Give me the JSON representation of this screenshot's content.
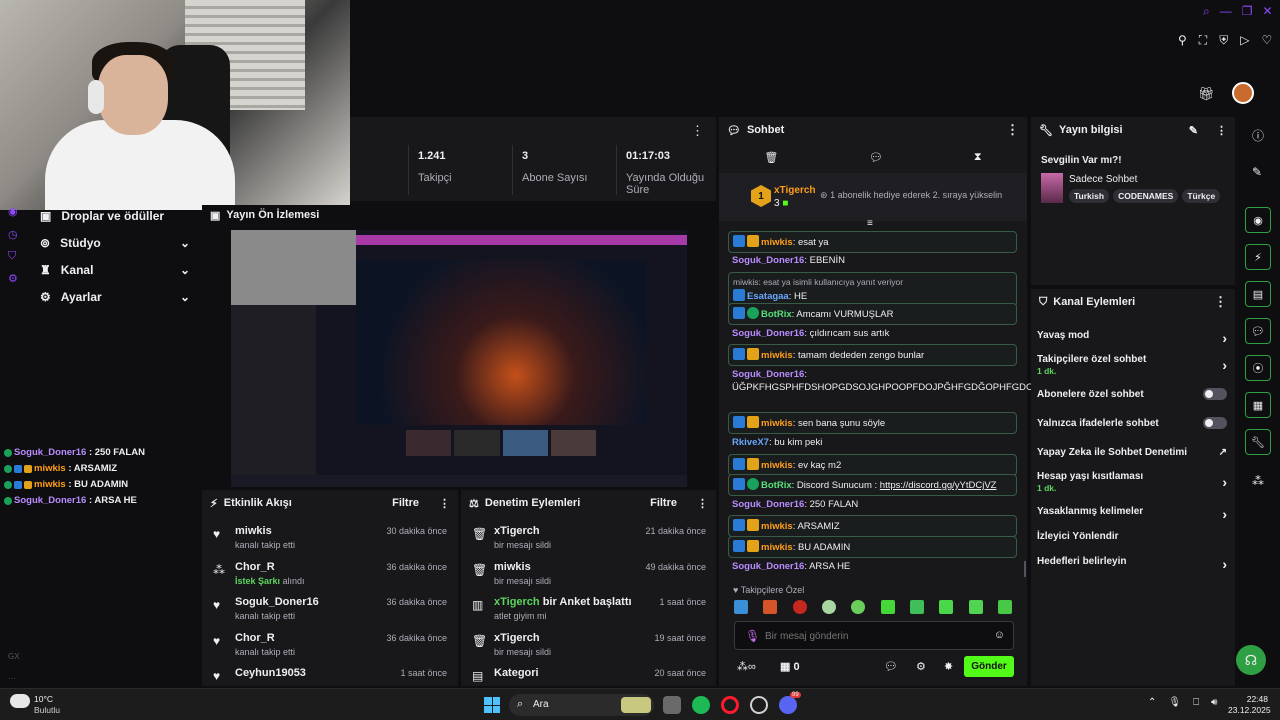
{
  "top": {
    "icons": [
      "search-icon",
      "minimize-icon",
      "restore-icon",
      "close-icon"
    ],
    "toolbar_icons": [
      "pin-icon",
      "screenshot-icon",
      "shield-icon",
      "play-icon",
      "heart-icon",
      "list-icon"
    ]
  },
  "left_nav": {
    "items": [
      {
        "label": "Droplar ve ödüller",
        "icon": "gift-icon"
      },
      {
        "label": "Stüdyo",
        "icon": "studio-icon"
      },
      {
        "label": "Kanal",
        "icon": "channel-icon"
      },
      {
        "label": "Ayarlar",
        "icon": "gear-icon"
      }
    ]
  },
  "stats": [
    {
      "value": "1.241",
      "label": "Takipçi"
    },
    {
      "value": "3",
      "label": "Abone Sayısı"
    },
    {
      "value": "01:17:03",
      "label": "Yayında Olduğu Süre"
    }
  ],
  "preview": {
    "title": "Yayın Ön İzlemesi"
  },
  "overlay_chat": [
    {
      "user": "Soguk_Doner16",
      "text": " : 250 FALAN",
      "color": "#b98cff"
    },
    {
      "user": "miwkis",
      "text": " : ARSAMIZ",
      "color": "#ff9e1b"
    },
    {
      "user": "miwkis",
      "text": " : BU ADAMIN",
      "color": "#ff9e1b"
    },
    {
      "user": "Soguk_Doner16",
      "text": " : ARSA HE",
      "color": "#b98cff"
    }
  ],
  "chat": {
    "title": "Sohbet",
    "gift": {
      "user": "xTigerch",
      "count": "3",
      "message": "1 abonelik hediye ederek 2. sıraya yükselin"
    },
    "messages": [
      {
        "user": "miwkis",
        "text": ": esat ya",
        "boxed": true,
        "ucls": "u-orange",
        "badges": [
          "b-blue",
          "b-crown"
        ]
      },
      {
        "user": "Soguk_Doner16",
        "text": ": EBENİN",
        "boxed": false,
        "ucls": "u-purple",
        "badges": []
      },
      {
        "reply": "miwkis: esat ya isimli kullanıcıya yanıt veriyor",
        "user": "Esatagaa",
        "text": ": HE",
        "boxed": true,
        "ucls": "u-blue",
        "badges": [
          "b-blue"
        ]
      },
      {
        "user": "BotRix",
        "text": ": Amcamı VURMUŞLAR",
        "boxed": true,
        "ucls": "u-green",
        "badges": [
          "b-blue",
          "b-green"
        ]
      },
      {
        "user": "Soguk_Doner16",
        "text": ": çıldırıcam sus artık",
        "boxed": false,
        "ucls": "u-purple",
        "badges": []
      },
      {
        "user": "miwkis",
        "text": ": tamam dededen zengo bunlar",
        "boxed": true,
        "ucls": "u-orange",
        "badges": [
          "b-blue",
          "b-crown"
        ]
      },
      {
        "user": "Soguk_Doner16",
        "text": ": ÜĞPKFHGSPHFDSHOPGDSOJGHPOOPFDOJPĞHFGDĞOPHFGDOPĞIHFGDOPĞHFGDOPĞFGHJOFDHGO",
        "boxed": false,
        "ucls": "u-purple",
        "badges": []
      },
      {
        "user": "miwkis",
        "text": ": sen bana şunu söyle",
        "boxed": true,
        "ucls": "u-orange",
        "badges": [
          "b-blue",
          "b-crown"
        ]
      },
      {
        "user": "RkiveX7",
        "text": ": bu kim peki",
        "boxed": false,
        "ucls": "u-blue",
        "badges": []
      },
      {
        "user": "miwkis",
        "text": ": ev kaç m2",
        "boxed": true,
        "ucls": "u-orange",
        "badges": [
          "b-blue",
          "b-crown"
        ]
      },
      {
        "user": "BotRix",
        "text": ": Discord Sunucum : ",
        "link": "https://discord.gg/yYtDCjVZ",
        "boxed": true,
        "ucls": "u-green",
        "badges": [
          "b-blue",
          "b-green"
        ]
      },
      {
        "user": "Soguk_Doner16",
        "text": ": 250 FALAN",
        "boxed": false,
        "ucls": "u-purple",
        "badges": []
      },
      {
        "user": "miwkis",
        "text": ": ARSAMIZ",
        "boxed": true,
        "ucls": "u-orange",
        "badges": [
          "b-blue",
          "b-crown"
        ]
      },
      {
        "user": "miwkis",
        "text": ": BU ADAMIN",
        "boxed": true,
        "ucls": "u-orange",
        "badges": [
          "b-blue",
          "b-crown"
        ]
      },
      {
        "user": "Soguk_Doner16",
        "text": ": ARSA HE",
        "boxed": false,
        "ucls": "u-purple",
        "badges": []
      }
    ],
    "emote_section": "Takipçilere Özel",
    "input_placeholder": "Bir mesaj gönderin",
    "points": "0",
    "send_label": "Gönder"
  },
  "activity": {
    "title": "Etkinlik Akışı",
    "filter": "Filtre",
    "items": [
      {
        "name": "miwkis",
        "sub": "kanalı takip etti",
        "time": "30 dakika önce",
        "icon": "heart-icon"
      },
      {
        "name": "Chor_R",
        "sub_highlight": "İstek Şarkı",
        "sub": " alındı",
        "time": "36 dakika önce",
        "icon": "points-icon"
      },
      {
        "name": "Soguk_Doner16",
        "sub": "kanalı takip etti",
        "time": "36 dakika önce",
        "icon": "heart-icon"
      },
      {
        "name": "Chor_R",
        "sub": "kanalı takip etti",
        "time": "36 dakika önce",
        "icon": "heart-icon"
      },
      {
        "name": "Ceyhun19053",
        "sub": "",
        "time": "1 saat önce",
        "icon": "heart-icon"
      }
    ]
  },
  "moderation": {
    "title": "Denetim Eylemleri",
    "filter": "Filtre",
    "items": [
      {
        "name": "xTigerch",
        "sub": "bir mesajı sildi",
        "time": "21 dakika önce",
        "icon": "trash-icon"
      },
      {
        "name": "miwkis",
        "sub": "bir mesajı sildi",
        "time": "49 dakika önce",
        "icon": "trash-icon"
      },
      {
        "name_highlight": "xTigerch",
        "name": " bir Anket başlattı",
        "sub": "atlet giyim mi",
        "time": "1 saat önce",
        "icon": "poll-icon"
      },
      {
        "name": "xTigerch",
        "sub": "bir mesajı sildi",
        "time": "19 saat önce",
        "icon": "trash-icon"
      },
      {
        "name": "Kategori",
        "sub": "",
        "time": "20 saat önce",
        "icon": "category-icon"
      }
    ]
  },
  "stream_info": {
    "title": "Yayın bilgisi",
    "stream_title": "Sevgilin Var mı?!",
    "category": "Sadece Sohbet",
    "tags": [
      "Turkish",
      "CODENAMES",
      "Türkçe"
    ]
  },
  "channel_actions": {
    "title": "Kanal Eylemleri",
    "rows": [
      {
        "label": "Yavaş mod",
        "control": "chevron"
      },
      {
        "label": "Takipçilere özel sohbet",
        "sub": "1 dk.",
        "control": "chevron"
      },
      {
        "label": "Abonelere özel sohbet",
        "control": "toggle"
      },
      {
        "label": "Yalnızca ifadelerle sohbet",
        "control": "toggle"
      },
      {
        "label": "Yapay Zeka ile Sohbet Denetimi",
        "control": "external"
      },
      {
        "label": "Hesap yaşı kısıtlaması",
        "sub": "1 dk.",
        "control": "chevron"
      },
      {
        "label": "Yasaklanmış kelimeler",
        "control": "chevron"
      },
      {
        "label": "İzleyici Yönlendir",
        "control": "none"
      },
      {
        "label": "Hedefleri belirleyin",
        "control": "chevron"
      }
    ]
  },
  "taskbar": {
    "weather_temp": "10°C",
    "weather_desc": "Bulutlu",
    "search_label": "Ara",
    "time": "22:48",
    "date": "23.12.2025",
    "discord_badge": "99"
  },
  "colors": {
    "accent": "#9147ff",
    "green": "#53fc18",
    "panel": "#18181b",
    "bg": "#0e0e10"
  }
}
